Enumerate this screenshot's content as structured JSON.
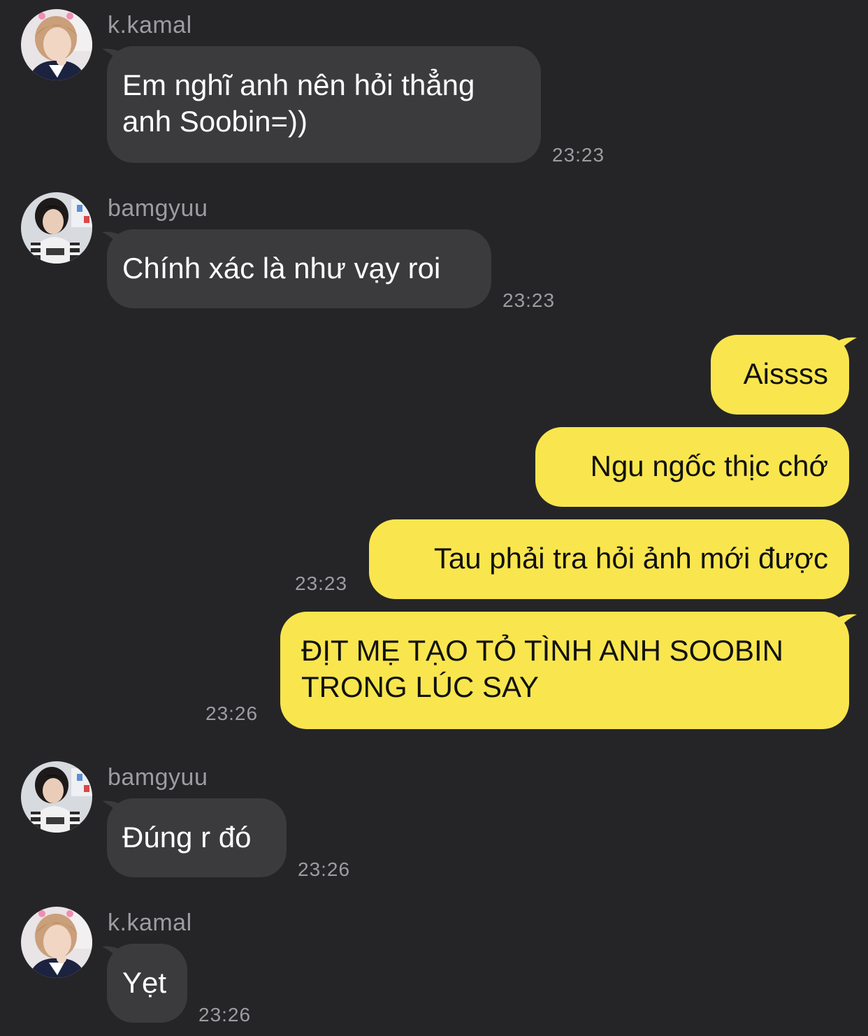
{
  "colors": {
    "background": "#252527",
    "incoming_bubble": "#3b3b3e",
    "outgoing_bubble": "#f9e64e",
    "meta_text": "#9c9ca1"
  },
  "avatars": [
    {
      "icon": "profile-photo-kkamal"
    },
    {
      "icon": "profile-photo-bamgyuu"
    },
    {
      "icon": "profile-photo-bamgyuu"
    },
    {
      "icon": "profile-photo-kkamal"
    }
  ],
  "messages": [
    {
      "sender": "k.kamal",
      "lines": [
        "Em nghĩ anh nên hỏi thẳng",
        "anh Soobin=))"
      ],
      "time": "23:23"
    },
    {
      "sender": "bamgyuu",
      "lines": [
        "Chính xác là như vạy roi"
      ],
      "time": "23:23"
    },
    {
      "lines": [
        "Aissss"
      ]
    },
    {
      "lines": [
        "Ngu ngốc thịc chớ"
      ]
    },
    {
      "lines": [
        "Tau phải tra hỏi ảnh mới được"
      ],
      "time": "23:23"
    },
    {
      "lines": [
        "ĐỊT MẸ TẠO TỎ TÌNH ANH SOOBIN",
        "TRONG LÚC SAY"
      ],
      "time": "23:26"
    },
    {
      "sender": "bamgyuu",
      "lines": [
        "Đúng r đó"
      ],
      "time": "23:26"
    },
    {
      "sender": "k.kamal",
      "lines": [
        "Yẹt"
      ],
      "time": "23:26"
    }
  ]
}
